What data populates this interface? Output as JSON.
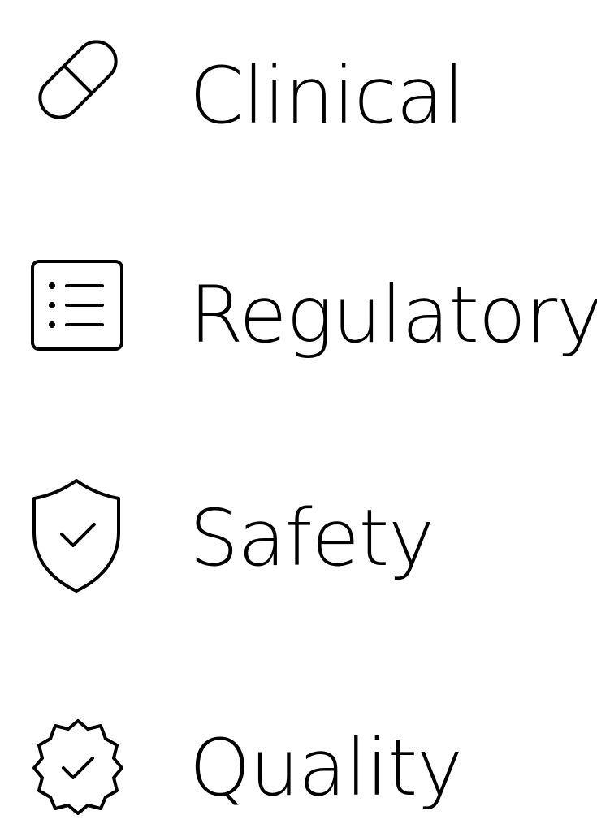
{
  "items": [
    {
      "label": "Clinical",
      "icon": "pill-icon"
    },
    {
      "label": "Regulatory",
      "icon": "list-icon"
    },
    {
      "label": "Safety",
      "icon": "shield-check-icon"
    },
    {
      "label": "Quality",
      "icon": "badge-check-icon"
    }
  ],
  "colors": {
    "foreground": "#000000",
    "background": "#ffffff"
  }
}
